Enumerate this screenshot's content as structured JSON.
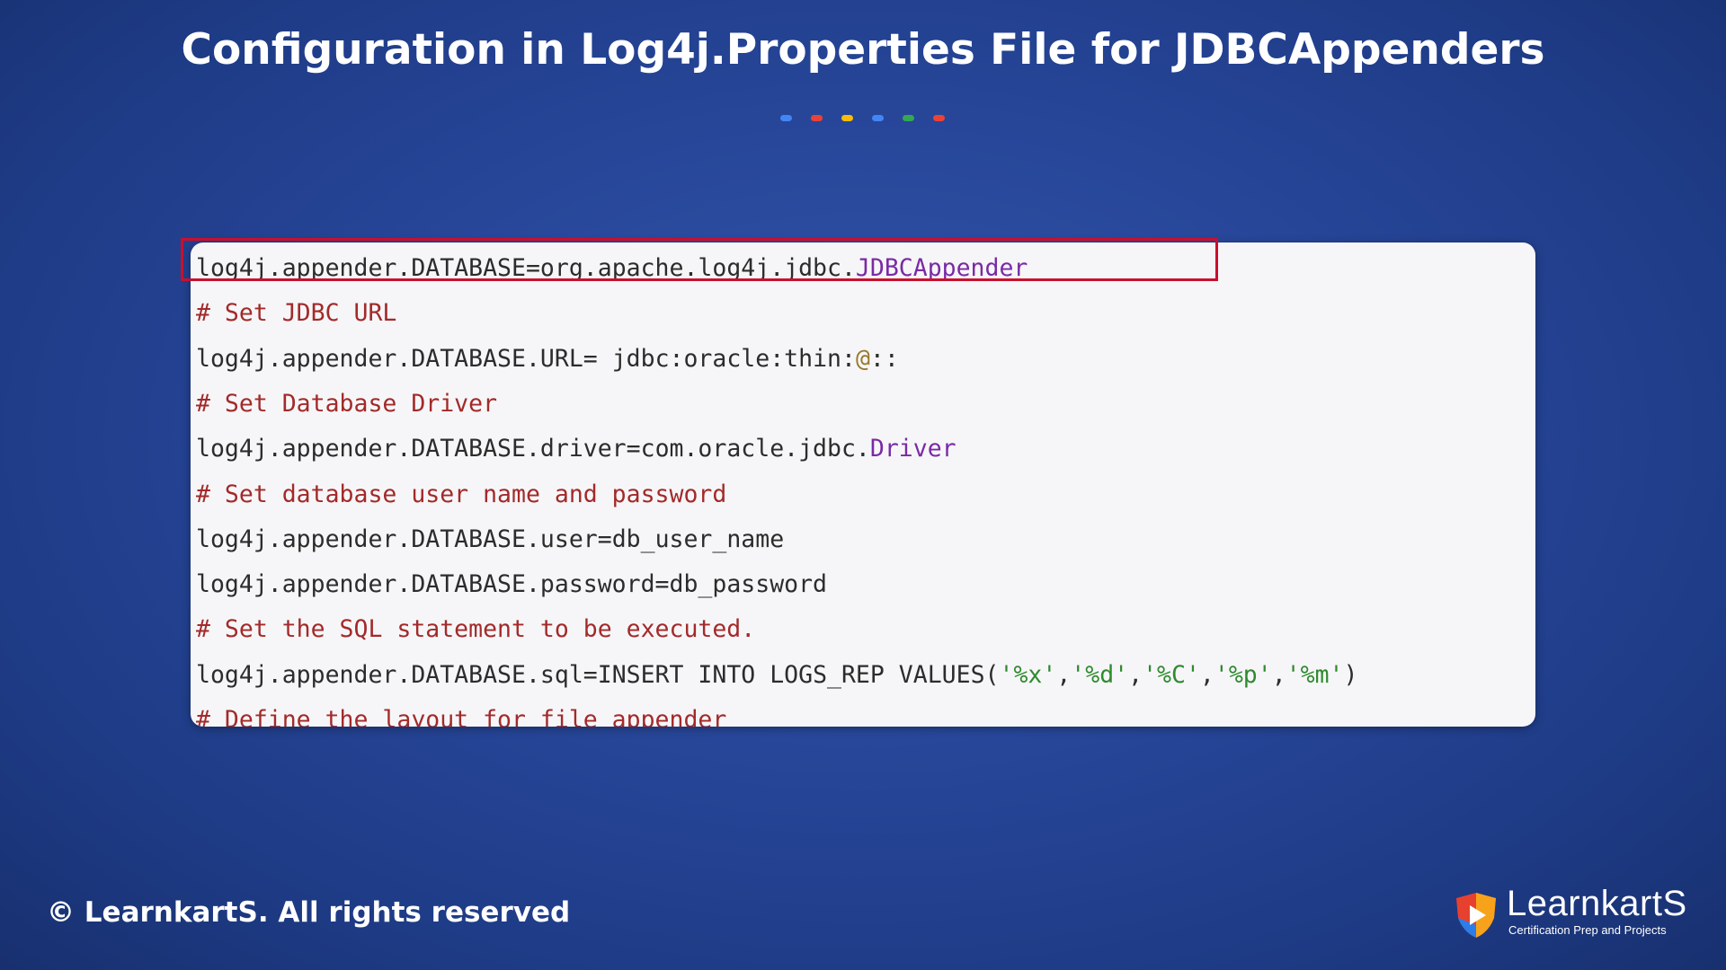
{
  "slide": {
    "title": "Configuration in Log4j.Properties File for JDBCAppenders",
    "dot_colors": [
      "#4285f4",
      "#ea4335",
      "#fbbc05",
      "#4285f4",
      "#34a853",
      "#ea4335"
    ]
  },
  "code": {
    "lines": [
      [
        {
          "text": "log4j.appender.DATABASE",
          "kind": "plain"
        },
        {
          "text": "=",
          "kind": "op"
        },
        {
          "text": "org.apache.log4j.jdbc.",
          "kind": "plain"
        },
        {
          "text": "JDBCAppender",
          "kind": "class"
        }
      ],
      [
        {
          "text": "# Set JDBC URL",
          "kind": "comment"
        }
      ],
      [
        {
          "text": "log4j.appender.DATABASE.URL",
          "kind": "plain"
        },
        {
          "text": "=",
          "kind": "op"
        },
        {
          "text": " jdbc:oracle:thin:",
          "kind": "plain"
        },
        {
          "text": "@",
          "kind": "sym"
        },
        {
          "text": "::",
          "kind": "plain"
        }
      ],
      [
        {
          "text": "# Set Database Driver",
          "kind": "comment"
        }
      ],
      [
        {
          "text": "log4j.appender.DATABASE.driver",
          "kind": "plain"
        },
        {
          "text": "=",
          "kind": "op"
        },
        {
          "text": "com.oracle.jdbc.",
          "kind": "plain"
        },
        {
          "text": "Driver",
          "kind": "class"
        }
      ],
      [
        {
          "text": "# Set database user name and password",
          "kind": "comment"
        }
      ],
      [
        {
          "text": "log4j.appender.DATABASE.user",
          "kind": "plain"
        },
        {
          "text": "=",
          "kind": "op"
        },
        {
          "text": "db_user_name",
          "kind": "plain"
        }
      ],
      [
        {
          "text": "log4j.appender.DATABASE.password",
          "kind": "plain"
        },
        {
          "text": "=",
          "kind": "op"
        },
        {
          "text": "db_password",
          "kind": "plain"
        }
      ],
      [
        {
          "text": "# Set the SQL statement to be executed.",
          "kind": "comment"
        }
      ],
      [
        {
          "text": "log4j.appender.DATABASE.sql",
          "kind": "plain"
        },
        {
          "text": "=",
          "kind": "op"
        },
        {
          "text": "INSERT INTO LOGS_REP VALUES(",
          "kind": "plain"
        },
        {
          "text": "'%x'",
          "kind": "str"
        },
        {
          "text": ",",
          "kind": "plain"
        },
        {
          "text": "'%d'",
          "kind": "str"
        },
        {
          "text": ",",
          "kind": "plain"
        },
        {
          "text": "'%C'",
          "kind": "str"
        },
        {
          "text": ",",
          "kind": "plain"
        },
        {
          "text": "'%p'",
          "kind": "str"
        },
        {
          "text": ",",
          "kind": "plain"
        },
        {
          "text": "'%m'",
          "kind": "str"
        },
        {
          "text": ")",
          "kind": "plain"
        }
      ],
      [
        {
          "text": "# Define the layout for file appender",
          "kind": "comment"
        }
      ]
    ]
  },
  "footer": {
    "copyright": "© LearnkartS. All rights reserved"
  },
  "logo": {
    "name": "LearnkartS",
    "tagline": "Certification Prep and Projects",
    "colors": [
      "#e8402f",
      "#f7a21b",
      "#2b7de9",
      "#ffffff"
    ]
  }
}
